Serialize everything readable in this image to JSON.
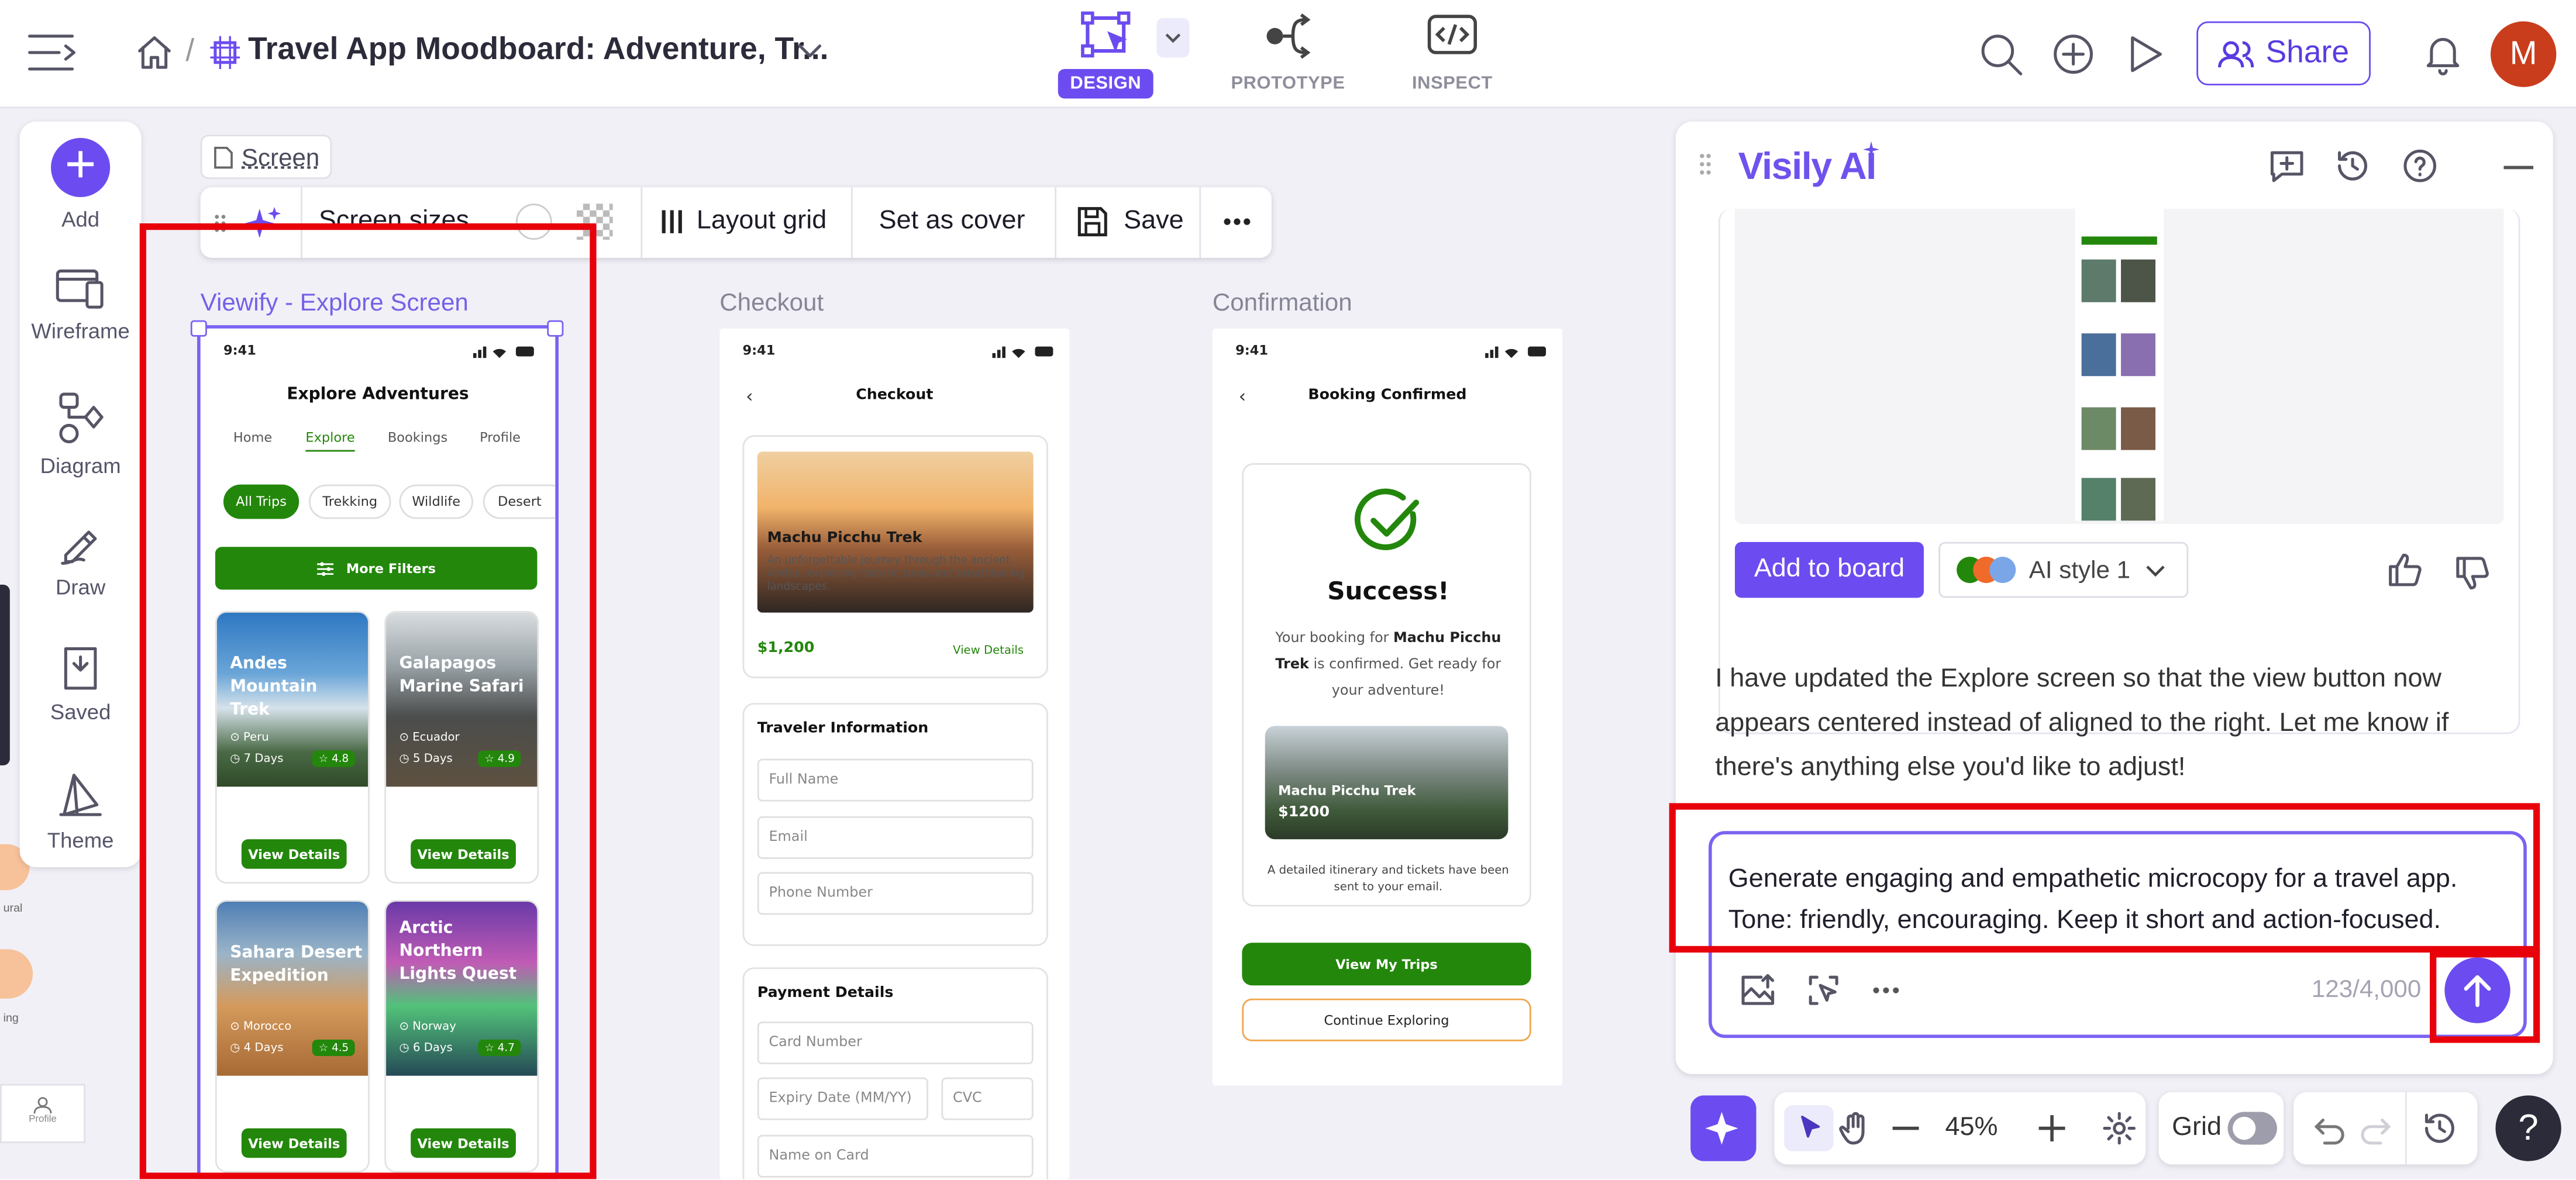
{
  "header": {
    "title": "Travel App Moodboard: Adventure, Tr...",
    "breadcrumb_sep": "/",
    "modes": [
      "DESIGN",
      "PROTOTYPE",
      "INSPECT"
    ],
    "share_label": "Share",
    "avatar_initial": "M"
  },
  "tools": {
    "add": "Add",
    "wireframe": "Wireframe",
    "diagram": "Diagram",
    "draw": "Draw",
    "saved": "Saved",
    "theme": "Theme",
    "profile_small": "Profile",
    "side_small_1": "ural",
    "side_small_2": "ing"
  },
  "canvas_toolbar": {
    "screen_tag": "Screen",
    "screen_sizes": "Screen sizes",
    "layout_grid": "Layout grid",
    "set_as_cover": "Set as cover",
    "save": "Save"
  },
  "frames": {
    "explore": {
      "label": "Viewify - Explore Screen",
      "time": "9:41",
      "title": "Explore Adventures",
      "tabs": [
        "Home",
        "Explore",
        "Bookings",
        "Profile"
      ],
      "chips": [
        "All Trips",
        "Trekking",
        "Wildlife",
        "Desert"
      ],
      "filters": "More Filters",
      "cards": [
        {
          "name": "Andes Mountain Trek",
          "place": "Peru",
          "days": "7 Days",
          "rating": "4.8",
          "btn": "View Details"
        },
        {
          "name": "Galapagos Marine Safari",
          "place": "Ecuador",
          "days": "5 Days",
          "rating": "4.9",
          "btn": "View Details"
        },
        {
          "name": "Sahara Desert Expedition",
          "place": "Morocco",
          "days": "4 Days",
          "rating": "4.5",
          "btn": "View Details"
        },
        {
          "name": "Arctic Northern Lights Quest",
          "place": "Norway",
          "days": "6 Days",
          "rating": "4.7",
          "btn": "View Details"
        }
      ]
    },
    "checkout": {
      "label": "Checkout",
      "time": "9:41",
      "title": "Checkout",
      "trip_name": "Machu Picchu Trek",
      "trip_desc": "An unforgettable journey through the ancient Andes, exploring historic ruins and breathtaking landscapes.",
      "price": "$1,200",
      "view_details": "View Details",
      "traveler_heading": "Traveler Information",
      "fields": [
        "Full Name",
        "Email",
        "Phone Number"
      ],
      "payment_heading": "Payment Details",
      "card_number": "Card Number",
      "expiry": "Expiry Date (MM/YY)",
      "cvc": "CVC",
      "name_on_card": "Name on Card"
    },
    "confirmation": {
      "label": "Confirmation",
      "time": "9:41",
      "title": "Booking Confirmed",
      "success": "Success!",
      "msg_pre": "Your booking for ",
      "msg_bold": "Machu Picchu Trek",
      "msg_post": " is confirmed. Get ready for your adventure!",
      "img_title": "Machu Picchu Trek",
      "img_price": "$1200",
      "detail_note": "A detailed itinerary and tickets have been sent to your email.",
      "primary_btn": "View My Trips",
      "secondary_btn": "Continue Exploring"
    }
  },
  "ai_panel": {
    "brand": "Visily AI",
    "add_to_board": "Add to board",
    "style": "AI style 1",
    "response": "I have updated the Explore screen so that the view button now appears centered instead of aligned to the right. Let me know if there's anything else you'd like to adjust!",
    "prompt": "Generate engaging and empathetic microcopy for a travel app. Tone: friendly, encouraging. Keep it short and action-focused.",
    "char_count": "123/4,000"
  },
  "bottom_bar": {
    "zoom": "45%",
    "grid_label": "Grid",
    "help": "?"
  },
  "colors": {
    "accent": "#6c4cf0",
    "green": "#23870b",
    "highlight": "#e8000b",
    "avatar": "#c93d1c"
  }
}
